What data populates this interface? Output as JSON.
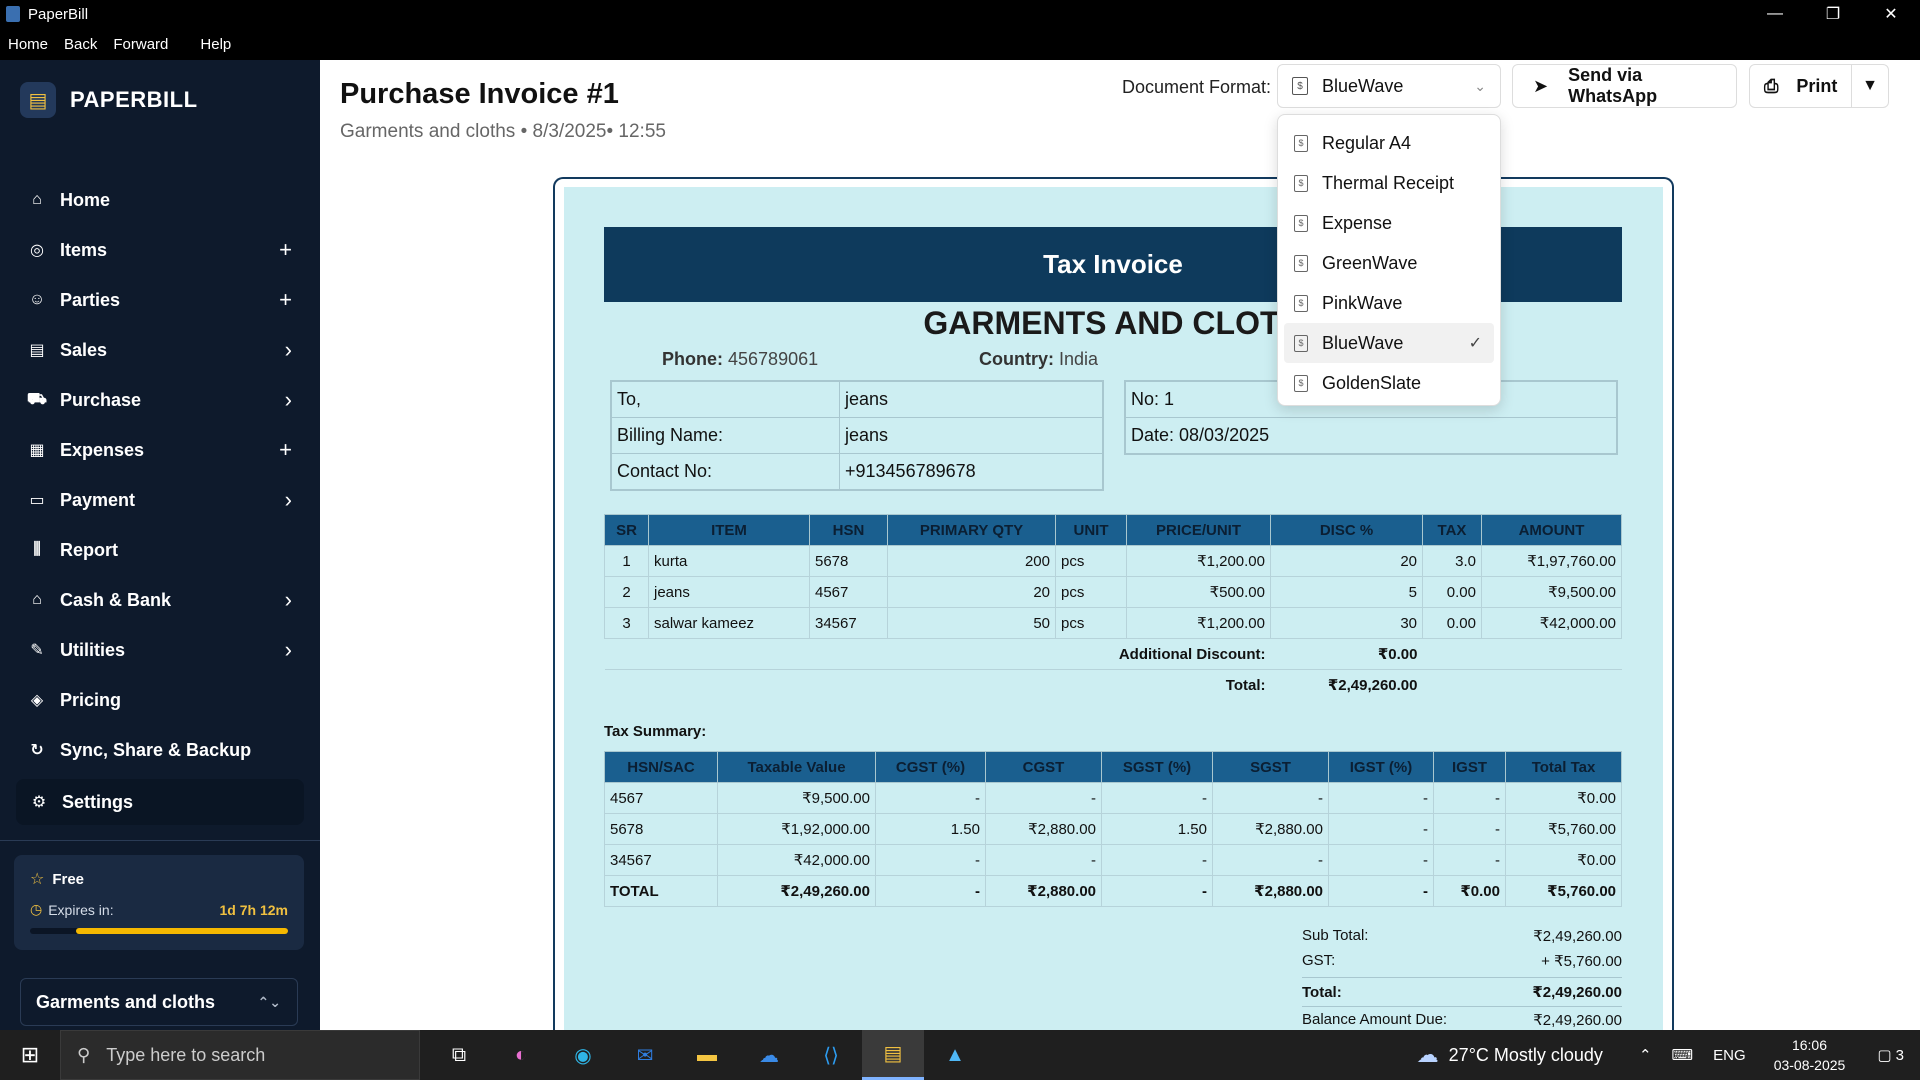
{
  "window": {
    "title": "PaperBill",
    "controls": [
      "—",
      "❐",
      "✕"
    ]
  },
  "menubar": {
    "items": [
      "Home",
      "Back",
      "Forward"
    ],
    "help": "Help"
  },
  "sidebar": {
    "brand": "PAPERBILL",
    "items": [
      {
        "label": "Home",
        "icon": "home-icon",
        "action": ""
      },
      {
        "label": "Items",
        "icon": "items-icon",
        "action": "+"
      },
      {
        "label": "Parties",
        "icon": "parties-icon",
        "action": "+"
      },
      {
        "label": "Sales",
        "icon": "sales-icon",
        "action": "›"
      },
      {
        "label": "Purchase",
        "icon": "cart-icon",
        "action": "›"
      },
      {
        "label": "Expenses",
        "icon": "expenses-icon",
        "action": "+"
      },
      {
        "label": "Payment",
        "icon": "wallet-icon",
        "action": "›"
      },
      {
        "label": "Report",
        "icon": "bar-chart-icon",
        "action": ""
      },
      {
        "label": "Cash & Bank",
        "icon": "bank-icon",
        "action": "›"
      },
      {
        "label": "Utilities",
        "icon": "wrench-icon",
        "action": "›"
      },
      {
        "label": "Pricing",
        "icon": "tag-icon",
        "action": ""
      },
      {
        "label": "Sync, Share & Backup",
        "icon": "sync-icon",
        "action": ""
      }
    ],
    "settings": "Settings",
    "plan": {
      "name": "Free",
      "expires_label": "Expires in:",
      "expires_value": "1d 7h 12m",
      "progress_fraction": 0.82
    },
    "company": "Garments and cloths"
  },
  "header": {
    "title": "Purchase Invoice #1",
    "subtitle": "Garments and cloths • 8/3/2025• 12:55",
    "format_label": "Document Format:",
    "format_value": "BlueWave",
    "whatsapp": "Send via WhatsApp",
    "print": "Print"
  },
  "dropdown": {
    "options": [
      "Regular A4",
      "Thermal Receipt",
      "Expense",
      "GreenWave",
      "PinkWave",
      "BlueWave",
      "GoldenSlate"
    ],
    "selected": "BlueWave"
  },
  "invoice": {
    "heading": "Tax Invoice",
    "company": "GARMENTS AND CLOTH",
    "phone_label": "Phone:",
    "phone": "456789061",
    "country_label": "Country:",
    "country": "India",
    "to_label": "To,",
    "to_value": "jeans",
    "billing_label": "Billing Name:",
    "billing_value": "jeans",
    "contact_label": "Contact No:",
    "contact_value": "+913456789678",
    "no": "No: 1",
    "date": "Date: 08/03/2025",
    "items_headers": [
      "SR",
      "ITEM",
      "HSN",
      "PRIMARY QTY",
      "UNIT",
      "PRICE/UNIT",
      "DISC %",
      "TAX",
      "AMOUNT"
    ],
    "items": [
      [
        "1",
        "kurta",
        "5678",
        "200",
        "pcs",
        "₹1,200.00",
        "20",
        "3.0",
        "₹1,97,760.00"
      ],
      [
        "2",
        "jeans",
        "4567",
        "20",
        "pcs",
        "₹500.00",
        "5",
        "0.00",
        "₹9,500.00"
      ],
      [
        "3",
        "salwar kameez",
        "34567",
        "50",
        "pcs",
        "₹1,200.00",
        "30",
        "0.00",
        "₹42,000.00"
      ]
    ],
    "additional_discount_label": "Additional Discount:",
    "additional_discount": "₹0.00",
    "total_label": "Total:",
    "total": "₹2,49,260.00",
    "tax_summary_label": "Tax Summary:",
    "tax_headers": [
      "HSN/SAC",
      "Taxable Value",
      "CGST (%)",
      "CGST",
      "SGST (%)",
      "SGST",
      "IGST (%)",
      "IGST",
      "Total Tax"
    ],
    "tax_rows": [
      [
        "4567",
        "₹9,500.00",
        "-",
        "-",
        "-",
        "-",
        "-",
        "-",
        "₹0.00"
      ],
      [
        "5678",
        "₹1,92,000.00",
        "1.50",
        "₹2,880.00",
        "1.50",
        "₹2,880.00",
        "-",
        "-",
        "₹5,760.00"
      ],
      [
        "34567",
        "₹42,000.00",
        "-",
        "-",
        "-",
        "-",
        "-",
        "-",
        "₹0.00"
      ]
    ],
    "tax_total": [
      "TOTAL",
      "₹2,49,260.00",
      "-",
      "₹2,880.00",
      "-",
      "₹2,880.00",
      "-",
      "₹0.00",
      "₹5,760.00"
    ],
    "summary": {
      "subtotal_label": "Sub Total:",
      "subtotal": "₹2,49,260.00",
      "gst_label": "GST:",
      "gst": "+ ₹5,760.00",
      "total_label": "Total:",
      "total": "₹2,49,260.00",
      "balance_label": "Balance Amount Due:",
      "balance": "₹2,49,260.00"
    }
  },
  "taskbar": {
    "search_placeholder": "Type here to search",
    "weather": "27°C  Mostly cloudy",
    "lang": "ENG",
    "time": "16:06",
    "date": "03-08-2025",
    "notifications": "3"
  },
  "colors": {
    "sidebar": "#0e1a2c",
    "invoice_bg": "#cdeef2",
    "invoice_header": "#0e3a5c",
    "table_header": "#1a5f8f",
    "accent": "#f5b800"
  }
}
